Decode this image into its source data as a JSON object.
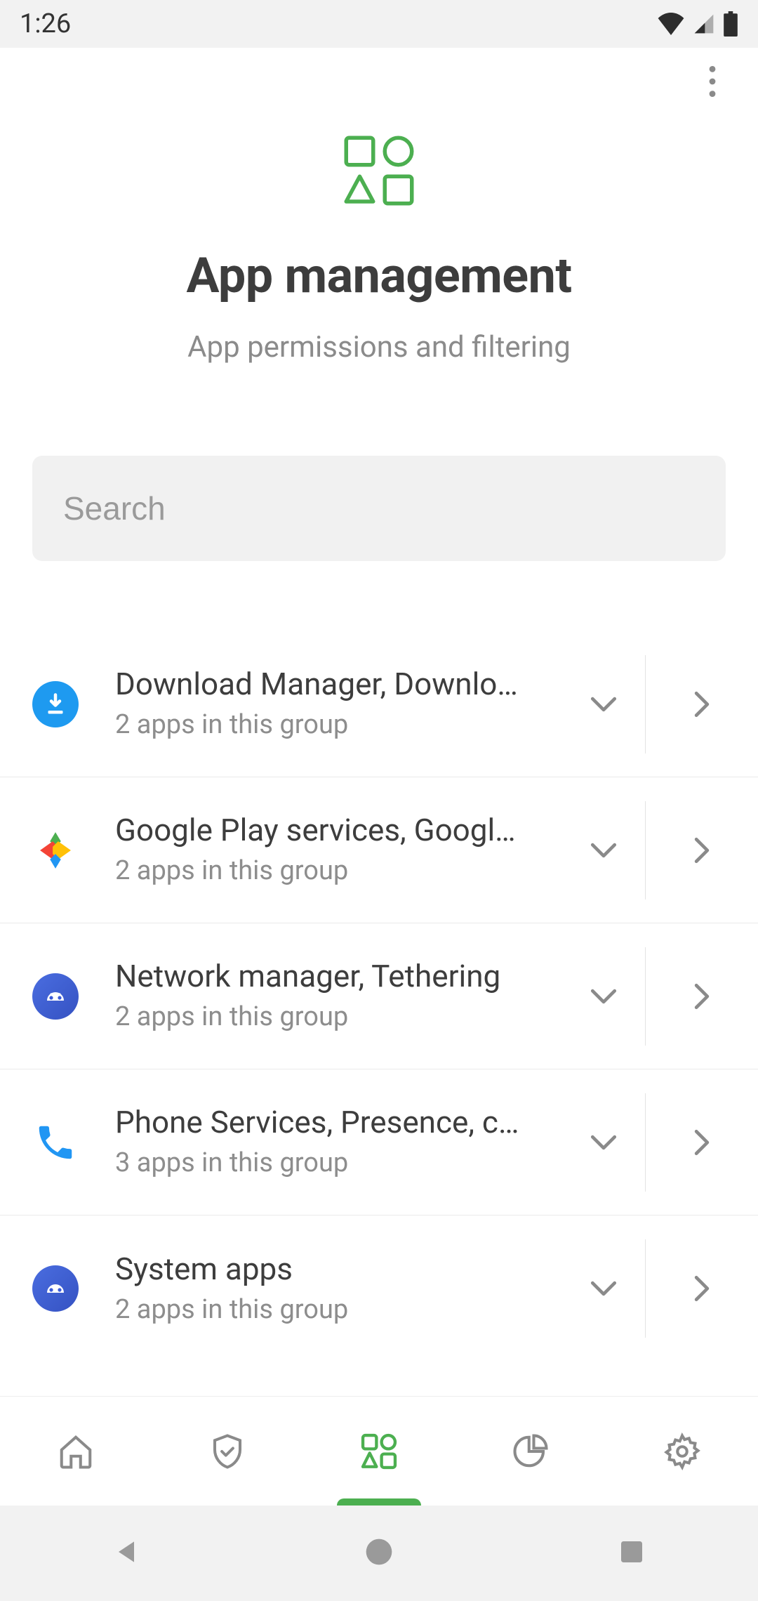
{
  "status": {
    "time": "1:26"
  },
  "hero": {
    "title": "App management",
    "subtitle": "App permissions and filtering"
  },
  "search": {
    "placeholder": "Search"
  },
  "groups": [
    {
      "label": "Download Manager, Downlo…",
      "count": "2 apps in this group",
      "icon": "download"
    },
    {
      "label": "Google Play services, Googl…",
      "count": "2 apps in this group",
      "icon": "play"
    },
    {
      "label": "Network manager, Tethering",
      "count": "2 apps in this group",
      "icon": "android"
    },
    {
      "label": "Phone Services, Presence, c…",
      "count": "3 apps in this group",
      "icon": "phone"
    },
    {
      "label": "System apps",
      "count": "2 apps in this group",
      "icon": "android"
    }
  ],
  "colors": {
    "accent": "#4caf50",
    "download": "#1e9af0",
    "phone": "#2196f3",
    "android": "#3b5bd9"
  }
}
